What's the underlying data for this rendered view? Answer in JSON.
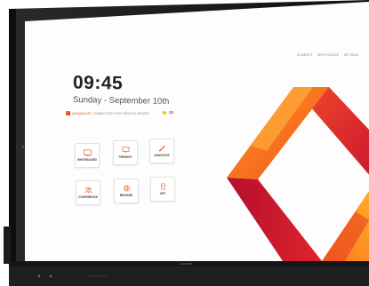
{
  "home": {
    "time": "09:45",
    "date": "Sunday - September 10th",
    "status_brand": "AVOQUALITY",
    "status_text": "CONNECTIVITY FOR CREATIVE GROUPS",
    "weather_temp": "26"
  },
  "topbar": {
    "items": [
      "ELEMENTS",
      "INPUT SOURCE",
      "SETTINGS"
    ]
  },
  "apps": [
    {
      "label": "WHITEBOARD",
      "icon": "whiteboard-icon"
    },
    {
      "label": "PRESENT",
      "icon": "present-icon"
    },
    {
      "label": "ANNOTATE",
      "icon": "annotate-icon"
    },
    {
      "label": "CONFERENCE",
      "icon": "conference-icon"
    },
    {
      "label": "BROWSE",
      "icon": "browse-icon"
    },
    {
      "label": "UPS",
      "icon": "ups-icon"
    }
  ],
  "bezel": {
    "brand": "AVOCOR"
  },
  "colors": {
    "accent_orange": "#f7931e",
    "accent_red": "#e8172d",
    "bezel": "#1a1a1c"
  }
}
